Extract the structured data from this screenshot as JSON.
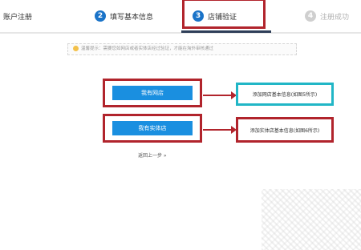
{
  "steps": [
    {
      "number": "",
      "label": "账户注册"
    },
    {
      "number": "2",
      "label": "填写基本信息"
    },
    {
      "number": "3",
      "label": "店铺验证"
    },
    {
      "number": "4",
      "label": "注册成功"
    }
  ],
  "tip": {
    "text": "温馨提示：需要您如网店或者实体店经过验证，才能在淘外审核通过"
  },
  "choices": [
    {
      "button_label": "我有网店",
      "info_label": "添加网店基本信息(如图5所示)"
    },
    {
      "button_label": "我有实体店",
      "info_label": "添加实体店基本信息(如图6所示)"
    }
  ],
  "prev_link": "返回上一步 »",
  "colors": {
    "accent": "#1a8fe0",
    "highlight_red": "#b1242c",
    "highlight_cyan": "#21b6c6"
  }
}
